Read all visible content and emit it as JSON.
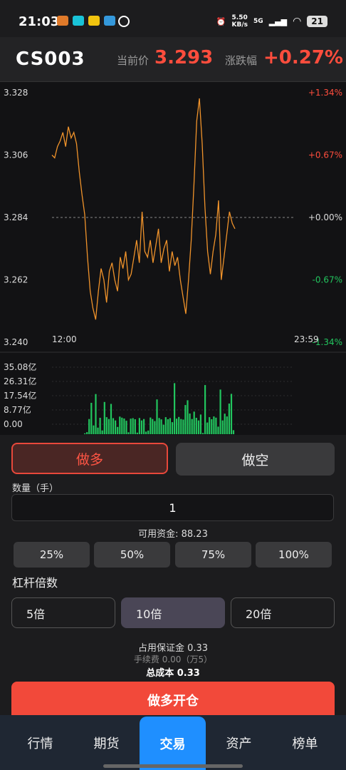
{
  "status_bar": {
    "time": "21:03",
    "net_speed": "5.50",
    "net_unit": "KB/s",
    "net_type": "5G",
    "battery": "21"
  },
  "header": {
    "symbol": "CS003",
    "price_label": "当前价",
    "price": "3.293",
    "change_label": "涨跌幅",
    "change": "+0.27%"
  },
  "chart_data": [
    {
      "type": "line",
      "title": "",
      "x_start_label": "12:00",
      "x_end_label": "23:59",
      "y_ticks": [
        "3.328",
        "3.306",
        "3.284",
        "3.262",
        "3.240"
      ],
      "pct_ticks": [
        "+1.34%",
        "+0.67%",
        "+0.00%",
        "-0.67%",
        "-1.34%"
      ],
      "ylim": [
        3.24,
        3.328
      ],
      "reference_price": 3.284,
      "series": [
        {
          "values": [
            3.306,
            3.305,
            3.309,
            3.311,
            3.314,
            3.309,
            3.316,
            3.312,
            3.314,
            3.31,
            3.3,
            3.292,
            3.285,
            3.27,
            3.258,
            3.252,
            3.248,
            3.258,
            3.266,
            3.262,
            3.254,
            3.265,
            3.268,
            3.262,
            3.258,
            3.27,
            3.266,
            3.272,
            3.262,
            3.264,
            3.27,
            3.276,
            3.268,
            3.286,
            3.272,
            3.27,
            3.276,
            3.268,
            3.274,
            3.28,
            3.268,
            3.273,
            3.276,
            3.265,
            3.272,
            3.267,
            3.27,
            3.262,
            3.256,
            3.25,
            3.262,
            3.276,
            3.296,
            3.318,
            3.326,
            3.31,
            3.288,
            3.272,
            3.264,
            3.272,
            3.278,
            3.29,
            3.262,
            3.27,
            3.278,
            3.286,
            3.282,
            3.28
          ]
        }
      ]
    },
    {
      "type": "bar",
      "title": "",
      "y_ticks": [
        "35.08亿",
        "26.31亿",
        "17.54亿",
        "8.77亿",
        "0.00"
      ],
      "ylim": [
        0,
        35.08
      ],
      "values": [
        0.5,
        1.2,
        8.8,
        18.2,
        5.1,
        23.3,
        3.8,
        9.5,
        2.2,
        18.7,
        9.9,
        8.8,
        17.6,
        9.3,
        8.0,
        4.2,
        10.2,
        9.6,
        9.1,
        7.8,
        1.1,
        9.0,
        9.3,
        8.7,
        0.9,
        9.4,
        8.0,
        8.8,
        1.5,
        2.1,
        9.7,
        8.8,
        7.6,
        20.2,
        9.4,
        8.6,
        5.5,
        9.9,
        8.7,
        9.3,
        7.0,
        29.6,
        9.0,
        10.0,
        8.8,
        8.5,
        16.9,
        19.7,
        12.0,
        8.8,
        13.1,
        9.5,
        8.0,
        11.4,
        0.7,
        28.5,
        6.8,
        9.9,
        8.7,
        10.3,
        9.6,
        4.4,
        25.9,
        8.0,
        11.9,
        10.3,
        17.8,
        23.4,
        2.3
      ],
      "colors": {
        "bar": "#22c55e"
      }
    }
  ],
  "trade": {
    "long_label": "做多",
    "short_label": "做空",
    "qty_label": "数量（手）",
    "qty_value": "1",
    "available": "可用资金: 88.23",
    "pct_buttons": [
      "25%",
      "50%",
      "75%",
      "100%"
    ],
    "leverage_title": "杠杆倍数",
    "leverage_options": [
      "5倍",
      "10倍",
      "20倍"
    ],
    "margin": "占用保证金 0.33",
    "fee": "手续费 0.00（万5）",
    "total": "总成本 0.33",
    "open_button": "做多开仓"
  },
  "tabs": [
    "行情",
    "期货",
    "交易",
    "资产",
    "榜单"
  ],
  "colors": {
    "up": "#ff4d3d",
    "down": "#22c55e",
    "line": "#f0932b",
    "accent": "#1f8fff"
  }
}
